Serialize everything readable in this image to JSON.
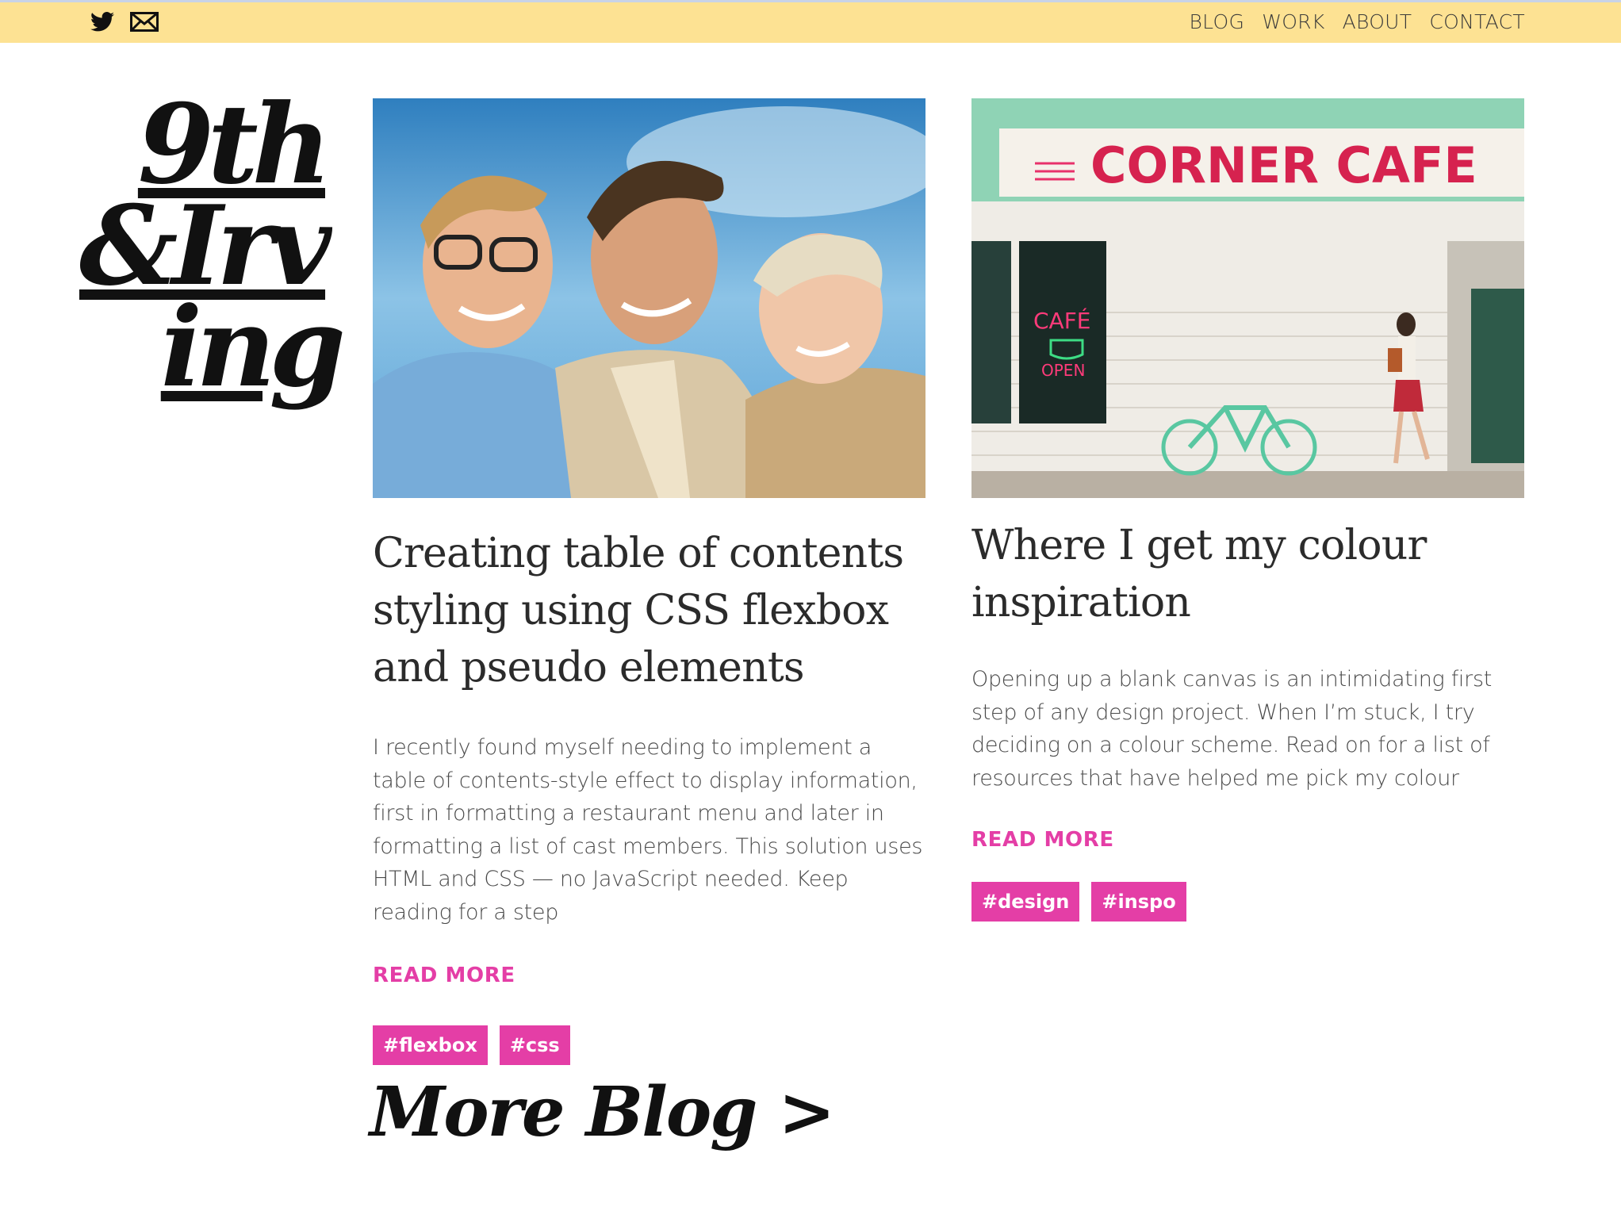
{
  "header": {
    "social": [
      {
        "icon": "twitter-icon"
      },
      {
        "icon": "mail-icon"
      }
    ],
    "nav": [
      "BLOG",
      "WORK",
      "ABOUT",
      "CONTACT"
    ]
  },
  "logo": {
    "line1": "9th",
    "line2": "&Irv",
    "line3": "ing"
  },
  "posts": [
    {
      "image_alt": "Three smiling people in sunlight",
      "title": "Creating table of contents styling using CSS flexbox and pseudo elements",
      "excerpt": "I recently found myself needing to implement a table of contents-style effect to display information, first in formatting a restaurant menu and later in formatting a list of cast members. This solution uses HTML and CSS — no JavaScript needed. Keep reading for a step",
      "read_more": "READ MORE",
      "tags": [
        "#flexbox",
        "#css"
      ]
    },
    {
      "image_alt": "Corner Cafe storefront with bicycle",
      "sign_text": "CORNER CAFE",
      "neon_line1": "CAFÉ",
      "neon_line2": "OPEN",
      "title": "Where I get my colour inspiration",
      "excerpt": "Opening up a blank canvas is an intimidating first step of any design project. When I’m stuck, I try deciding on a colour scheme. Read on for a list of resources that have helped me pick my colour",
      "read_more": "READ MORE",
      "tags": [
        "#design",
        "#inspo"
      ]
    }
  ],
  "more_blog": "More Blog >",
  "colors": {
    "topbar": "#fde293",
    "accent": "#e43ea6",
    "text": "#2b2b2b"
  }
}
